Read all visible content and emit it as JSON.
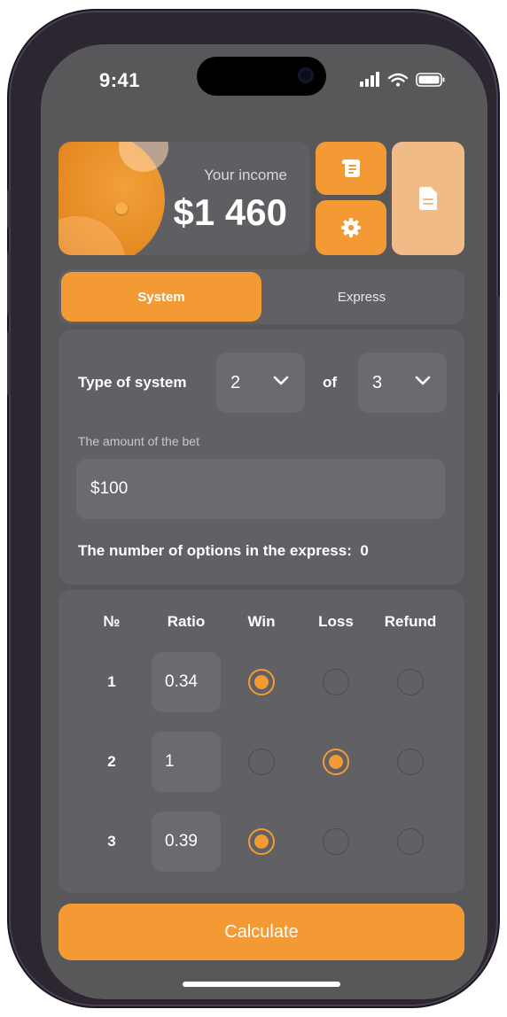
{
  "status_bar": {
    "time": "9:41"
  },
  "income": {
    "label": "Your income",
    "value": "$1 460"
  },
  "header_buttons": {
    "history_icon": "scroll-icon",
    "settings_icon": "gear-icon",
    "document_icon": "document-icon"
  },
  "tabs": [
    {
      "label": "System",
      "active": true
    },
    {
      "label": "Express",
      "active": false
    }
  ],
  "system": {
    "type_label": "Type of system",
    "first_value": "2",
    "of_label": "of",
    "second_value": "3",
    "bet_label": "The amount of the bet",
    "bet_value": "$100",
    "options_label": "The number of options in the express:",
    "options_count": "0"
  },
  "table": {
    "headers": [
      "№",
      "Ratio",
      "Win",
      "Loss",
      "Refund"
    ],
    "rows": [
      {
        "number": "1",
        "ratio": "0.34",
        "result": "Win"
      },
      {
        "number": "2",
        "ratio": "1",
        "result": "Loss"
      },
      {
        "number": "3",
        "ratio": "0.39",
        "result": "Win"
      }
    ]
  },
  "calculate_label": "Calculate",
  "colors": {
    "accent": "#f39a35",
    "accent_light": "#f0bb86",
    "background": "#58575a",
    "panel": "#616064"
  }
}
